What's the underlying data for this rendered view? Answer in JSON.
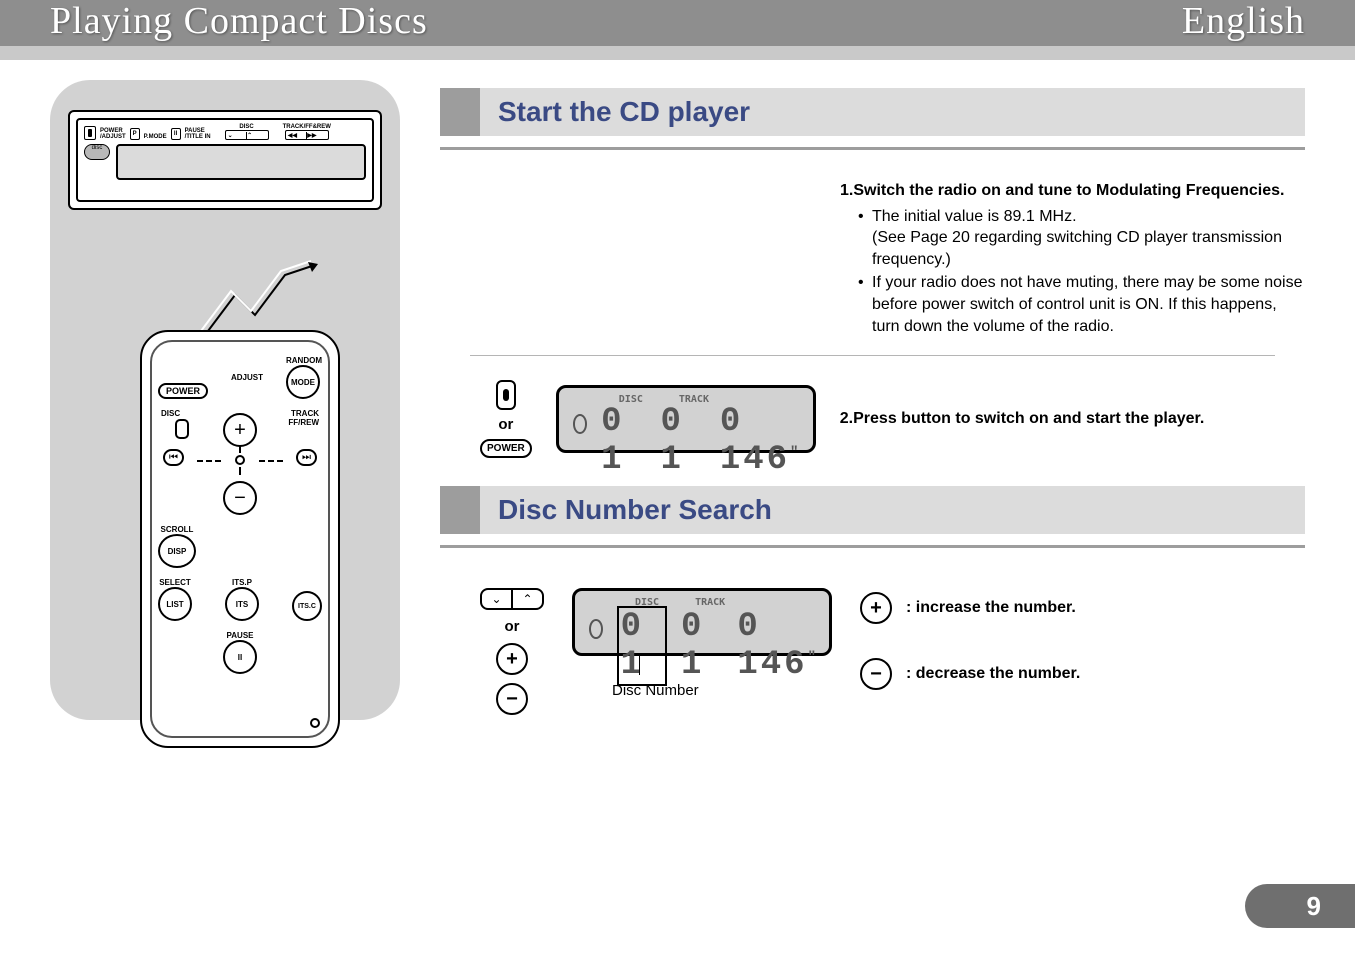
{
  "header": {
    "left": "Playing Compact Discs",
    "right": "English"
  },
  "section1": {
    "title": "Start the CD player",
    "step1_num": "1.",
    "step1_bold": "Switch the radio on and tune to Modulating Frequencies.",
    "step1_b1a": "The initial value is 89.1 MHz.",
    "step1_b1b": "(See Page 20 regarding switching CD player transmission frequency.)",
    "step1_b2": "If your radio does not have muting, there may be some noise before power switch of control unit is ON. If this happens, turn down the volume of the radio.",
    "or": "or",
    "power_label": "POWER",
    "step2_num": "2.",
    "step2_bold": "Press button to switch on and start the player."
  },
  "lcd": {
    "disc_label": "DISC",
    "track_label": "TRACK",
    "disc": "0 1",
    "track": "0 1",
    "time": "0 146",
    "quote1": "'",
    "quote2": "\""
  },
  "section2": {
    "title": "Disc Number Search",
    "or": "or",
    "caption": "Disc Number",
    "plus_desc": ": increase the number.",
    "minus_desc": ": decrease the number."
  },
  "remote": {
    "random": "RANDOM",
    "power": "POWER",
    "adjust": "ADJUST",
    "mode": "MODE",
    "disc": "DISC",
    "track": "TRACK\nFF/REW",
    "plus": "+",
    "minus": "−",
    "scroll": "SCROLL",
    "disp": "DISP",
    "select": "SELECT",
    "itsp": "ITS.P",
    "list": "LIST",
    "its": "ITS",
    "itsc": "ITS.C",
    "pause": "PAUSE",
    "pause_sym": "II",
    "rev": "⏮",
    "fwd": "⏭"
  },
  "headunit": {
    "power": "POWER\n/ADJUST",
    "pmode": "P.MODE",
    "pause": "PAUSE\n/TITLE IN",
    "disc": "DISC",
    "track": "TRACK/FF&REW",
    "rev": "◀◀",
    "fwd": "▶▶",
    "up": "⌃",
    "down": "⌄",
    "disc_badge": "disc"
  },
  "icons": {
    "plus": "+",
    "minus": "−",
    "chev_down": "⌄",
    "chev_up": "⌃"
  },
  "page_number": "9"
}
